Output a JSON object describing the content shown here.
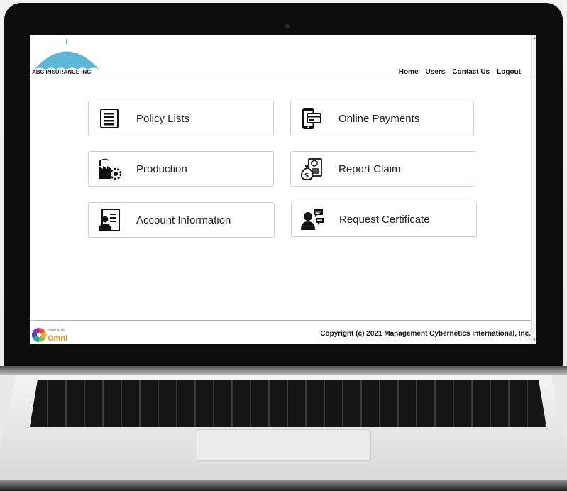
{
  "company": {
    "name": "ABC INSURANCE INC."
  },
  "nav": {
    "home": "Home",
    "users": "Users",
    "contact": "Contact Us",
    "logout": "Logout"
  },
  "tiles": {
    "policy_lists": "Policy Lists",
    "online_payments": "Online Payments",
    "production": "Production",
    "report_claim": "Report Claim",
    "account_information": "Account Information",
    "request_certificate": "Request Certificate"
  },
  "footer": {
    "powered_by": "Powered By",
    "brand": "Omni",
    "copyright": "Copyright (c) 2021 Management Cybernetics International, Inc."
  },
  "colors": {
    "header_rule": "#c0392b",
    "umbrella": "#5bb8d8"
  },
  "icons": [
    "umbrella-logo",
    "list-icon",
    "mobile-payment-icon",
    "factory-icon",
    "money-claim-icon",
    "account-card-icon",
    "user-chat-icon",
    "omni-logo"
  ]
}
